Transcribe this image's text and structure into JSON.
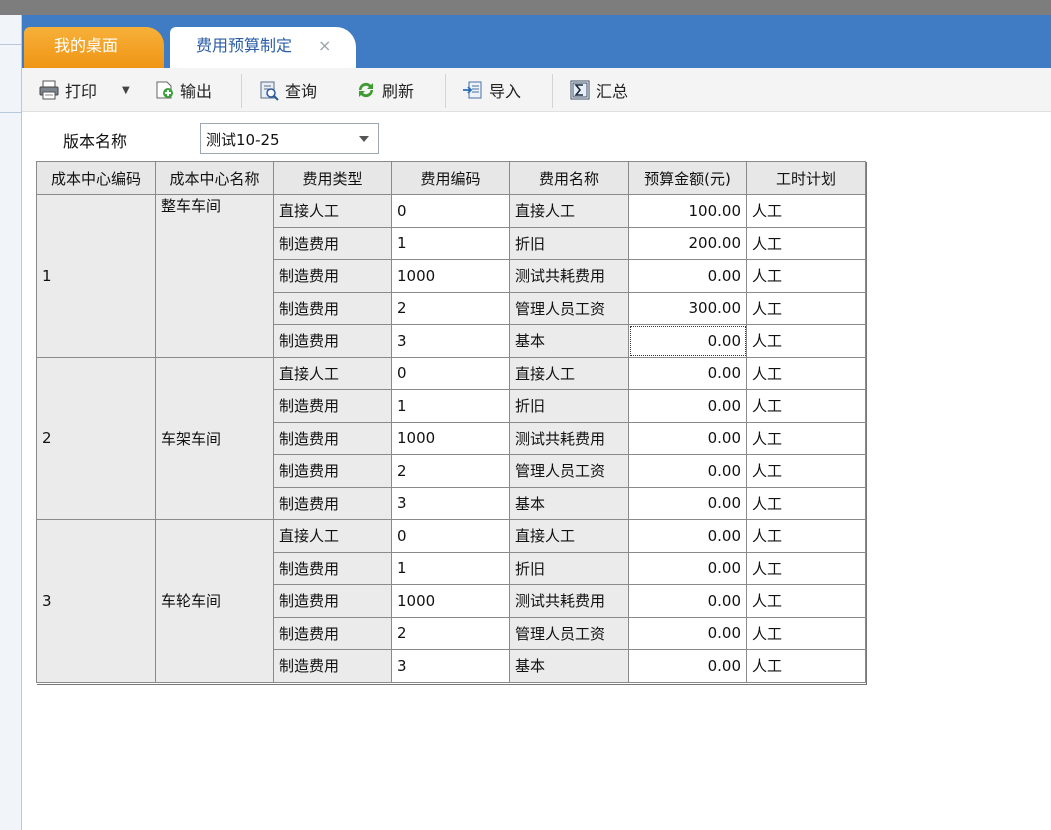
{
  "tabs": [
    {
      "label": "我的桌面",
      "active": false
    },
    {
      "label": "费用预算制定",
      "active": true,
      "close": "×"
    }
  ],
  "toolbar": {
    "print": "打印",
    "export": "输出",
    "query": "查询",
    "refresh": "刷新",
    "import": "导入",
    "summary": "汇总"
  },
  "filter": {
    "label": "版本名称",
    "value": "测试10-25"
  },
  "table": {
    "columns": [
      "成本中心编码",
      "成本中心名称",
      "费用类型",
      "费用编码",
      "费用名称",
      "预算金额(元)",
      "工时计划"
    ],
    "tooltip": "1",
    "groups": [
      {
        "code": "1",
        "name": "整车车间",
        "rows": [
          [
            "直接人工",
            "0",
            "直接人工",
            "100.00",
            "人工"
          ],
          [
            "制造费用",
            "1",
            "折旧",
            "200.00",
            "人工"
          ],
          [
            "制造费用",
            "1000",
            "测试共耗费用",
            "0.00",
            "人工"
          ],
          [
            "制造费用",
            "2",
            "管理人员工资",
            "300.00",
            "人工"
          ],
          [
            "制造费用",
            "3",
            "基本",
            "0.00",
            "人工"
          ]
        ]
      },
      {
        "code": "2",
        "name": "车架车间",
        "rows": [
          [
            "直接人工",
            "0",
            "直接人工",
            "0.00",
            "人工"
          ],
          [
            "制造费用",
            "1",
            "折旧",
            "0.00",
            "人工"
          ],
          [
            "制造费用",
            "1000",
            "测试共耗费用",
            "0.00",
            "人工"
          ],
          [
            "制造费用",
            "2",
            "管理人员工资",
            "0.00",
            "人工"
          ],
          [
            "制造费用",
            "3",
            "基本",
            "0.00",
            "人工"
          ]
        ]
      },
      {
        "code": "3",
        "name": "车轮车间",
        "rows": [
          [
            "直接人工",
            "0",
            "直接人工",
            "0.00",
            "人工"
          ],
          [
            "制造费用",
            "1",
            "折旧",
            "0.00",
            "人工"
          ],
          [
            "制造费用",
            "1000",
            "测试共耗费用",
            "0.00",
            "人工"
          ],
          [
            "制造费用",
            "2",
            "管理人员工资",
            "0.00",
            "人工"
          ],
          [
            "制造费用",
            "3",
            "基本",
            "0.00",
            "人工"
          ]
        ]
      }
    ]
  }
}
